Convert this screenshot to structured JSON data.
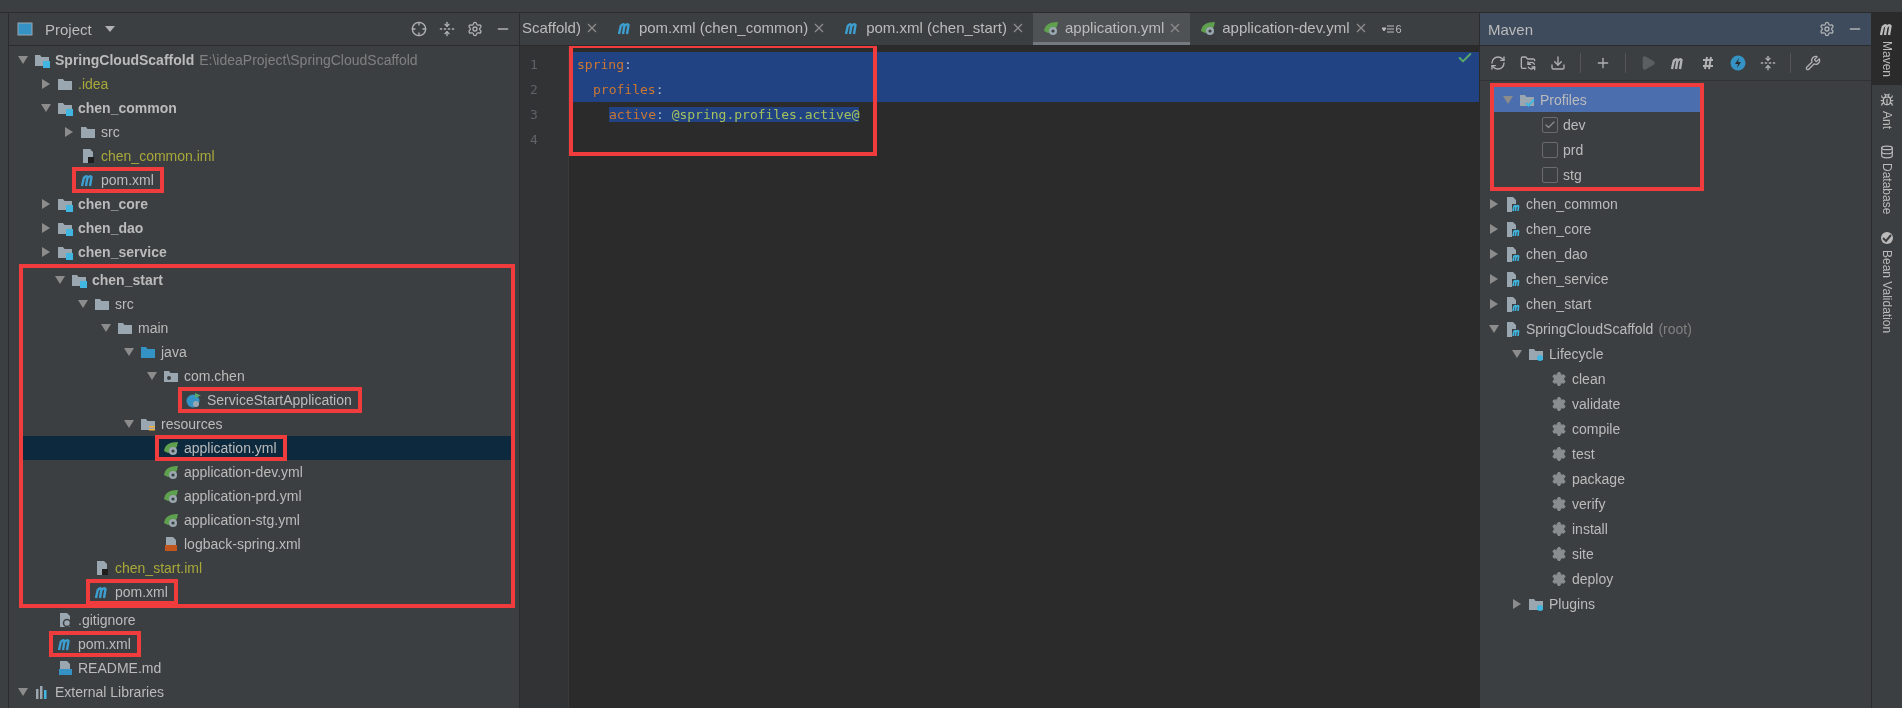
{
  "project_panel": {
    "title": "Project",
    "tree": [
      {
        "label": "SpringCloudScaffold",
        "path": "E:\\ideaProject\\SpringCloudScaffold",
        "kind": "module",
        "expanded": true,
        "selected": false,
        "children": [
          {
            "label": ".idea",
            "kind": "excluded",
            "expanded": false,
            "selected": false
          },
          {
            "label": "chen_common",
            "kind": "module",
            "expanded": true,
            "selected": false,
            "children": [
              {
                "label": "src",
                "kind": "folder",
                "expanded": false,
                "selected": false
              },
              {
                "label": "chen_common.iml",
                "kind": "iml",
                "selected": false
              },
              {
                "label": "pom.xml",
                "kind": "pom",
                "selected": false,
                "highlighted": true
              }
            ]
          },
          {
            "label": "chen_core",
            "kind": "module",
            "expanded": false,
            "selected": false
          },
          {
            "label": "chen_dao",
            "kind": "module",
            "expanded": false,
            "selected": false
          },
          {
            "label": "chen_service",
            "kind": "module",
            "expanded": false,
            "selected": false
          },
          {
            "label": "chen_start",
            "kind": "module",
            "expanded": true,
            "selected": false,
            "highlighted": true,
            "children": [
              {
                "label": "src",
                "kind": "folder",
                "expanded": true,
                "selected": false,
                "children": [
                  {
                    "label": "main",
                    "kind": "folder",
                    "expanded": true,
                    "selected": false,
                    "children": [
                      {
                        "label": "java",
                        "kind": "source",
                        "expanded": true,
                        "selected": false,
                        "children": [
                          {
                            "label": "com.chen",
                            "kind": "package",
                            "expanded": true,
                            "selected": false,
                            "children": [
                              {
                                "label": "ServiceStartApplication",
                                "kind": "class",
                                "selected": false,
                                "highlighted": true
                              }
                            ]
                          }
                        ]
                      },
                      {
                        "label": "resources",
                        "kind": "resources",
                        "expanded": true,
                        "selected": false,
                        "children": [
                          {
                            "label": "application.yml",
                            "kind": "spring",
                            "selected": true,
                            "highlighted": true
                          },
                          {
                            "label": "application-dev.yml",
                            "kind": "spring",
                            "selected": false
                          },
                          {
                            "label": "application-prd.yml",
                            "kind": "spring",
                            "selected": false
                          },
                          {
                            "label": "application-stg.yml",
                            "kind": "spring",
                            "selected": false
                          },
                          {
                            "label": "logback-spring.xml",
                            "kind": "xml",
                            "selected": false
                          }
                        ]
                      }
                    ]
                  }
                ]
              },
              {
                "label": "chen_start.iml",
                "kind": "iml",
                "selected": false
              },
              {
                "label": "pom.xml",
                "kind": "pom",
                "selected": false,
                "highlighted": true
              }
            ]
          },
          {
            "label": ".gitignore",
            "kind": "gitignore",
            "selected": false
          },
          {
            "label": "pom.xml",
            "kind": "pom",
            "selected": false,
            "highlighted": true
          },
          {
            "label": "README.md",
            "kind": "md",
            "selected": false
          }
        ]
      },
      {
        "label": "External Libraries",
        "kind": "libraries",
        "expanded": true,
        "selected": false
      }
    ]
  },
  "editor": {
    "tabs": [
      {
        "label": "Scaffold)",
        "selected": false,
        "partial": true
      },
      {
        "label": "pom.xml (chen_common)",
        "kind": "pom",
        "selected": false
      },
      {
        "label": "pom.xml (chen_start)",
        "kind": "pom",
        "selected": false
      },
      {
        "label": "application.yml",
        "kind": "spring",
        "selected": true
      },
      {
        "label": "application-dev.yml",
        "kind": "spring",
        "selected": false
      }
    ],
    "hidden_tabs": "6",
    "highlighted": true,
    "line_numbers": [
      "1",
      "2",
      "3",
      "4"
    ],
    "code": [
      {
        "key": "spring",
        "separator": ":",
        "selected": true,
        "children": [
          {
            "key": "profiles",
            "separator": ":",
            "selected": true,
            "children": [
              {
                "key": "active",
                "separator": ":",
                "value": "@spring.profiles.active@",
                "selected": true
              }
            ]
          }
        ]
      }
    ]
  },
  "maven_panel": {
    "title": "Maven",
    "tree": [
      {
        "label": "Profiles",
        "kind": "profiles",
        "expanded": true,
        "selected": true,
        "highlighted": true,
        "children": [
          {
            "label": "dev",
            "kind": "profile",
            "checked": true,
            "selected": false
          },
          {
            "label": "prd",
            "kind": "profile",
            "checked": false,
            "selected": false
          },
          {
            "label": "stg",
            "kind": "profile",
            "checked": false,
            "selected": false
          }
        ]
      },
      {
        "label": "chen_common",
        "kind": "maven-module",
        "expanded": false,
        "selected": false
      },
      {
        "label": "chen_core",
        "kind": "maven-module",
        "expanded": false,
        "selected": false
      },
      {
        "label": "chen_dao",
        "kind": "maven-module",
        "expanded": false,
        "selected": false
      },
      {
        "label": "chen_service",
        "kind": "maven-module",
        "expanded": false,
        "selected": false
      },
      {
        "label": "chen_start",
        "kind": "maven-module",
        "expanded": false,
        "selected": false
      },
      {
        "label": "SpringCloudScaffold",
        "suffix": "(root)",
        "kind": "maven-module",
        "expanded": true,
        "selected": false,
        "children": [
          {
            "label": "Lifecycle",
            "kind": "lifecycle",
            "expanded": true,
            "selected": false,
            "children": [
              {
                "label": "clean",
                "kind": "goal",
                "selected": false
              },
              {
                "label": "validate",
                "kind": "goal",
                "selected": false
              },
              {
                "label": "compile",
                "kind": "goal",
                "selected": false
              },
              {
                "label": "test",
                "kind": "goal",
                "selected": false
              },
              {
                "label": "package",
                "kind": "goal",
                "selected": false
              },
              {
                "label": "verify",
                "kind": "goal",
                "selected": false
              },
              {
                "label": "install",
                "kind": "goal",
                "selected": false
              },
              {
                "label": "site",
                "kind": "goal",
                "selected": false
              },
              {
                "label": "deploy",
                "kind": "goal",
                "selected": false
              }
            ]
          },
          {
            "label": "Plugins",
            "kind": "lifecycle",
            "expanded": false,
            "selected": false
          }
        ]
      }
    ]
  },
  "right_stripe": [
    {
      "label": "Maven",
      "kind": "maven",
      "selected": true
    },
    {
      "label": "Ant",
      "kind": "ant",
      "selected": false
    },
    {
      "label": "Database",
      "kind": "database",
      "selected": false
    },
    {
      "label": "Bean Validation",
      "kind": "bean",
      "selected": false
    }
  ]
}
